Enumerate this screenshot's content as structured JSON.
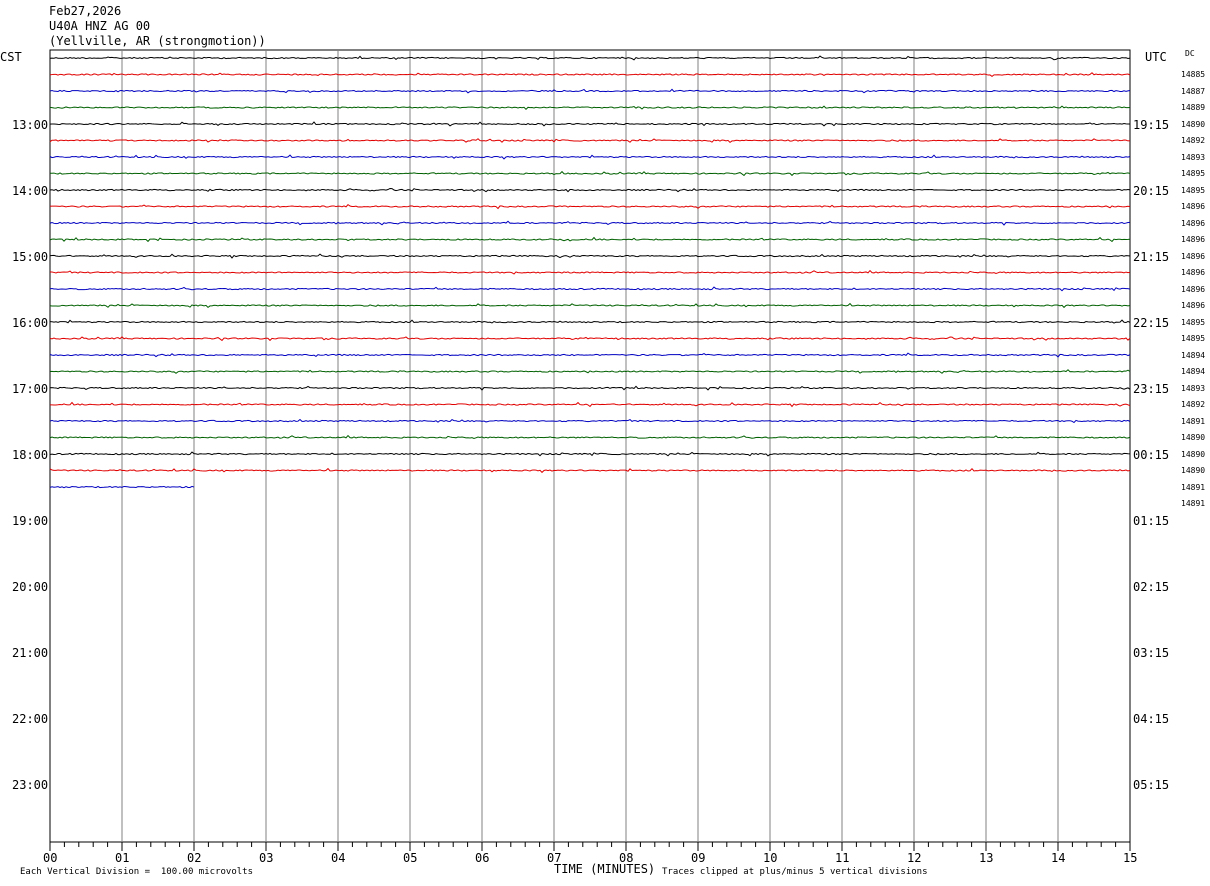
{
  "header": {
    "date": "Feb27,2026",
    "station": "U40A HNZ AG 00",
    "location": "(Yellville, AR (strongmotion))"
  },
  "left_tz": "CST",
  "right_tz": "UTC",
  "dc_header": "DC",
  "footer": {
    "scale_note": "Each Vertical Division =  100.00 microvolts",
    "x_title": "TIME (MINUTES)",
    "clip_note": "Traces clipped at plus/minus 5 vertical divisions"
  },
  "colors": {
    "cycle": [
      "#000000",
      "#e00000",
      "#0000c0",
      "#006000"
    ],
    "grid": "#808080"
  },
  "chart_data": {
    "type": "line",
    "xlabel": "TIME (MINUTES)",
    "xlim": [
      0,
      15
    ],
    "x_ticks": [
      "00",
      "01",
      "02",
      "03",
      "04",
      "05",
      "06",
      "07",
      "08",
      "09",
      "10",
      "11",
      "12",
      "13",
      "14",
      "15"
    ],
    "hour_labels_cst": [
      "13:00",
      "14:00",
      "15:00",
      "16:00",
      "17:00",
      "18:00",
      "19:00",
      "20:00",
      "21:00",
      "22:00",
      "23:00"
    ],
    "hour_labels_utc": [
      "19:15",
      "20:15",
      "21:15",
      "22:15",
      "23:15",
      "00:15",
      "01:15",
      "02:15",
      "03:15",
      "04:15",
      "05:15"
    ],
    "series": [
      {
        "dc": "14885",
        "end_minute": 15
      },
      {
        "dc": "14887",
        "end_minute": 15
      },
      {
        "dc": "14889",
        "end_minute": 15
      },
      {
        "dc": "14890",
        "end_minute": 15
      },
      {
        "dc": "14892",
        "end_minute": 15
      },
      {
        "dc": "14893",
        "end_minute": 15
      },
      {
        "dc": "14895",
        "end_minute": 15
      },
      {
        "dc": "14895",
        "end_minute": 15
      },
      {
        "dc": "14896",
        "end_minute": 15
      },
      {
        "dc": "14896",
        "end_minute": 15
      },
      {
        "dc": "14896",
        "end_minute": 15
      },
      {
        "dc": "14896",
        "end_minute": 15
      },
      {
        "dc": "14896",
        "end_minute": 15
      },
      {
        "dc": "14896",
        "end_minute": 15
      },
      {
        "dc": "14896",
        "end_minute": 15
      },
      {
        "dc": "14895",
        "end_minute": 15
      },
      {
        "dc": "14895",
        "end_minute": 15
      },
      {
        "dc": "14894",
        "end_minute": 15
      },
      {
        "dc": "14894",
        "end_minute": 15
      },
      {
        "dc": "14893",
        "end_minute": 15
      },
      {
        "dc": "14892",
        "end_minute": 15
      },
      {
        "dc": "14891",
        "end_minute": 15
      },
      {
        "dc": "14890",
        "end_minute": 15
      },
      {
        "dc": "14890",
        "end_minute": 15
      },
      {
        "dc": "14890",
        "end_minute": 15
      },
      {
        "dc": "14891",
        "end_minute": 15
      },
      {
        "dc": "14891",
        "end_minute": 2
      }
    ]
  }
}
